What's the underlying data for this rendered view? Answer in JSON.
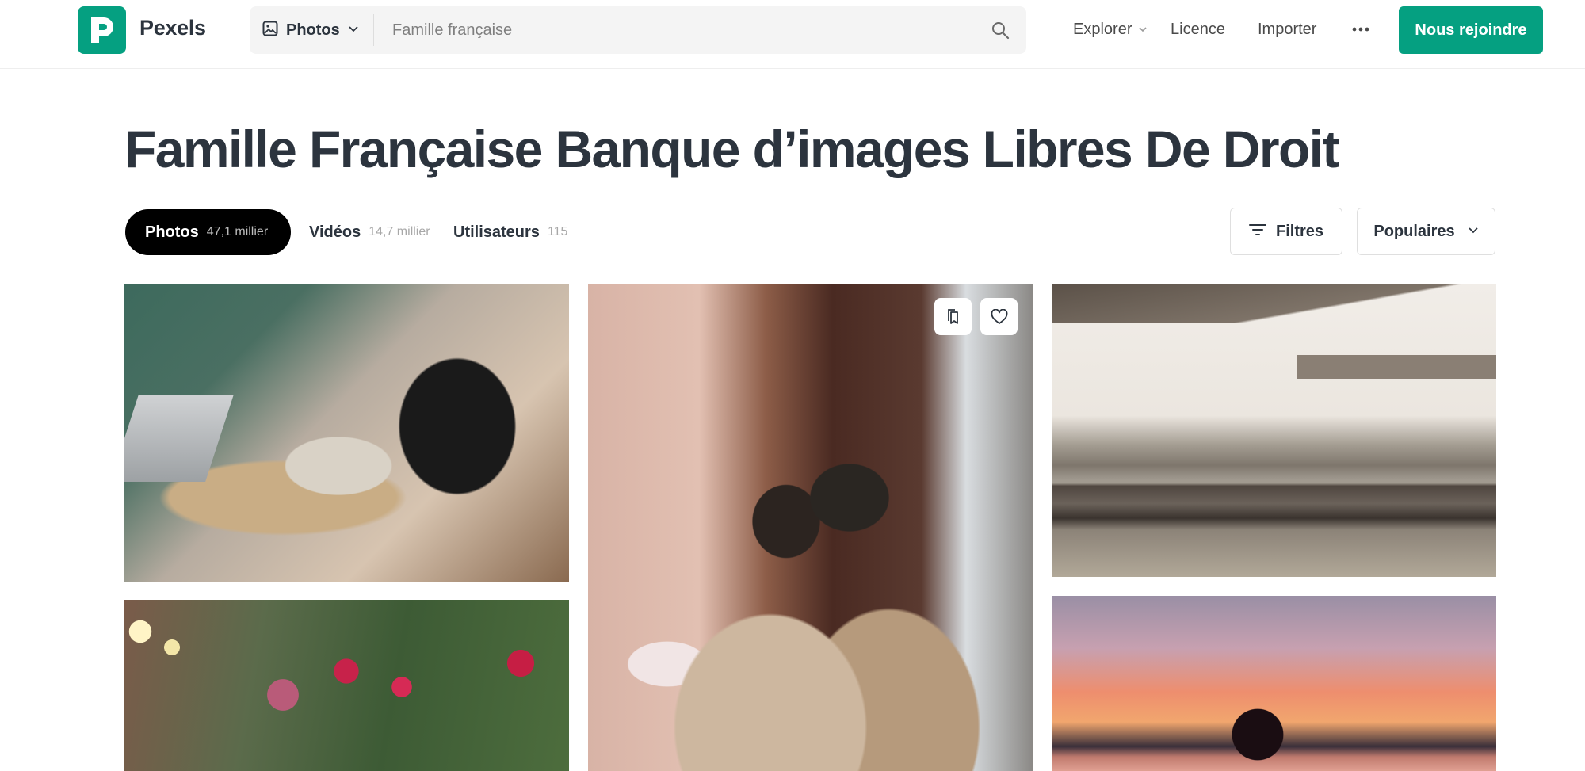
{
  "header": {
    "logo_text": "Pexels",
    "search": {
      "type_label": "Photos",
      "placeholder": "Famille française",
      "value": ""
    },
    "nav": {
      "explore": "Explorer",
      "licence": "Licence",
      "import": "Importer"
    },
    "join_label": "Nous rejoindre"
  },
  "page": {
    "title": "Famille Française Banque d’images Libres De Droit"
  },
  "tabs": [
    {
      "label": "Photos",
      "count": "47,1 millier",
      "active": true
    },
    {
      "label": "Vidéos",
      "count": "14,7 millier",
      "active": false
    },
    {
      "label": "Utilisateurs",
      "count": "115",
      "active": false
    }
  ],
  "controls": {
    "filters_label": "Filtres",
    "sort_label": "Populaires"
  },
  "colors": {
    "brand": "#05a081",
    "text": "#2c343e",
    "active_tab_bg": "#000000"
  },
  "icons": {
    "logo": "pexels-logo-icon",
    "search_type": "image-icon",
    "search": "search-icon",
    "more": "more-horizontal-icon",
    "filters": "filter-lines-icon",
    "collect": "collection-bookmark-icon",
    "like": "heart-icon"
  }
}
